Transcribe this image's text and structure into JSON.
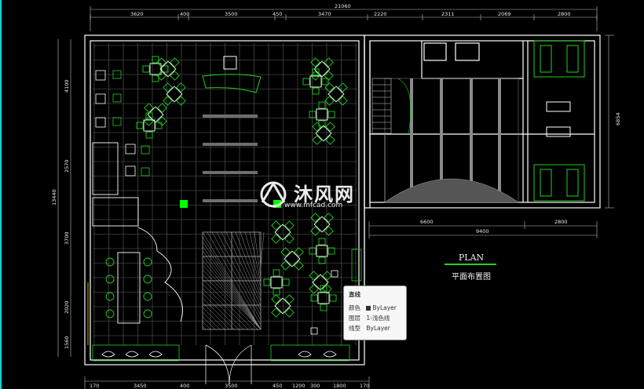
{
  "drawing": {
    "top_dimensions": {
      "total": "21060",
      "segments": [
        "3620",
        "400",
        "3500",
        "450",
        "3470",
        "2220",
        "2311",
        "2069",
        "2800"
      ]
    },
    "bottom_dimensions": {
      "segments": [
        "170",
        "3450",
        "400",
        "3500",
        "450",
        "1200",
        "300",
        "1800",
        "170"
      ]
    },
    "left_dimensions": {
      "total": "13440",
      "segments": [
        "4100",
        "2570",
        "3700",
        "2020",
        "1560"
      ]
    },
    "right_dimensions": {
      "total": "6854"
    },
    "right_lower_dimensions": {
      "row1": [
        "6600",
        "2800"
      ],
      "row2": "9400"
    },
    "plan_title": "PLAN",
    "plan_subtitle": "平面布置图"
  },
  "properties_tooltip": {
    "title": "直线",
    "rows": [
      {
        "label": "颜色",
        "value": "ByLayer",
        "swatch": "#333333"
      },
      {
        "label": "图层",
        "value": "1-浅色线"
      },
      {
        "label": "线型",
        "value": "ByLayer"
      }
    ]
  },
  "watermark": {
    "name": "沐风网",
    "url": "www.mfcad.com"
  },
  "colors": {
    "background": "#000000",
    "linework": "#ffffff",
    "furniture": "#1fd11f",
    "grid": "#6a6a6a",
    "accent": "#00ff00",
    "viewport_edge": "#00d8d8"
  }
}
